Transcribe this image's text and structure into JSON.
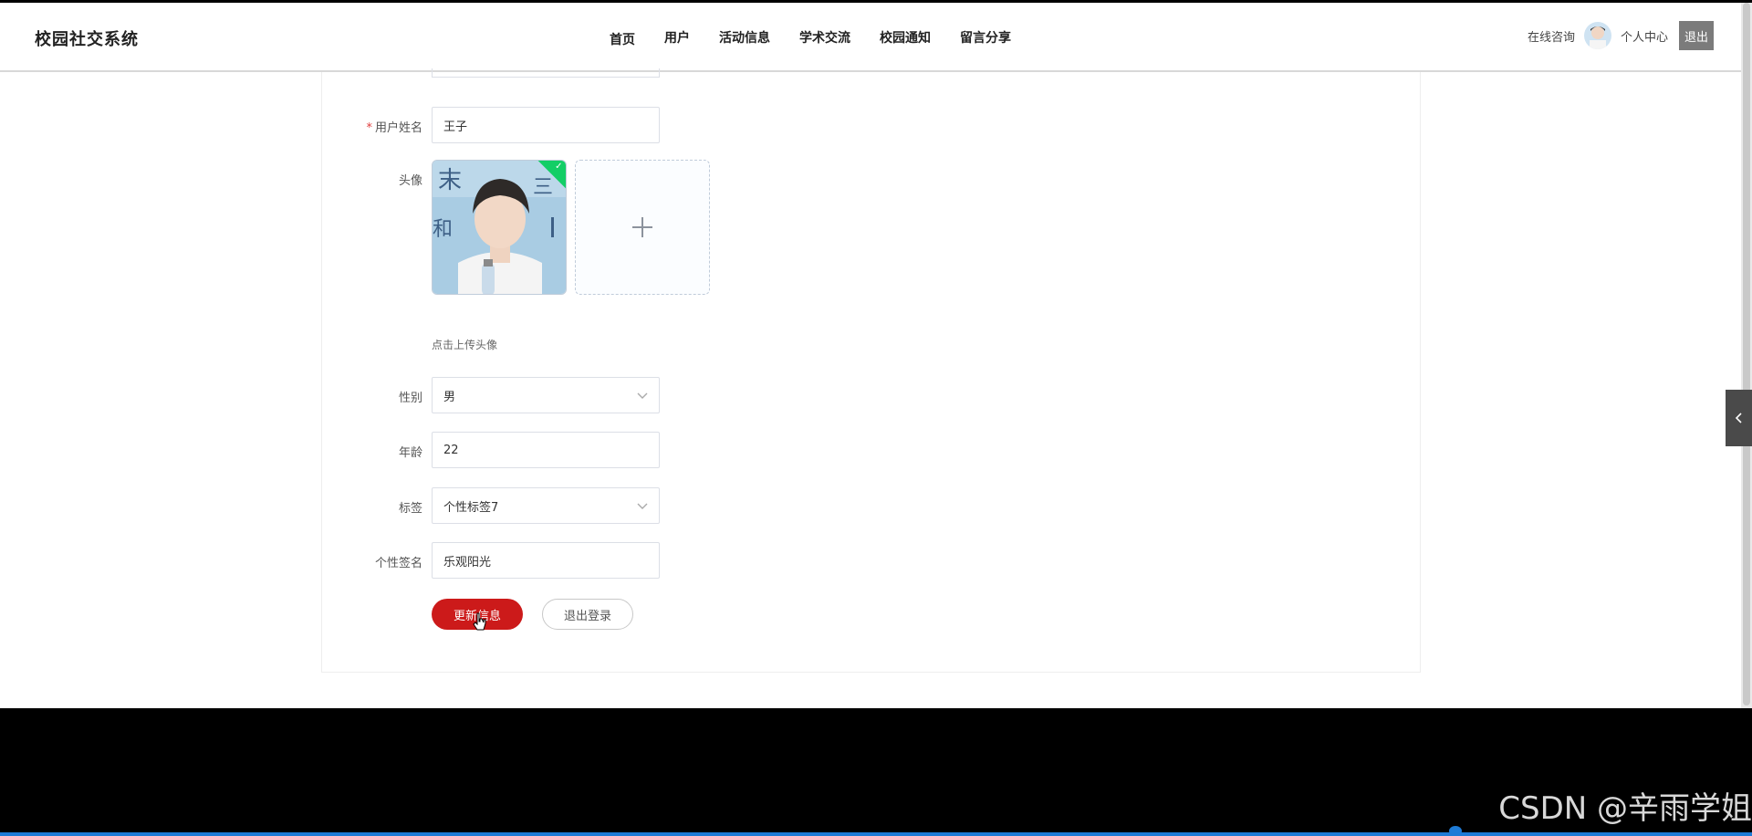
{
  "app": {
    "title": "校园社交系统"
  },
  "nav": {
    "items": [
      {
        "label": "首页"
      },
      {
        "label": "用户"
      },
      {
        "label": "活动信息"
      },
      {
        "label": "学术交流"
      },
      {
        "label": "校园通知"
      },
      {
        "label": "留言分享"
      }
    ]
  },
  "header": {
    "consult": "在线咨询",
    "personal_center": "个人中心",
    "logout": "退出"
  },
  "form": {
    "name": {
      "required_mark": "*",
      "label": "用户姓名",
      "value": "王子"
    },
    "avatar": {
      "label": "头像",
      "hint": "点击上传头像"
    },
    "gender": {
      "label": "性别",
      "value": "男"
    },
    "age": {
      "label": "年龄",
      "value": "22"
    },
    "tag": {
      "label": "标签",
      "value": "个性标签7"
    },
    "signature": {
      "label": "个性签名",
      "value": "乐观阳光"
    },
    "update_button": "更新信息",
    "logout_button": "退出登录"
  },
  "watermark": "CSDN @辛雨学姐",
  "colors": {
    "primary": "#cc1a1a",
    "success": "#13ce66",
    "logout_bg": "#7b7b7b",
    "accent_bottom": "#1e7bd6"
  }
}
